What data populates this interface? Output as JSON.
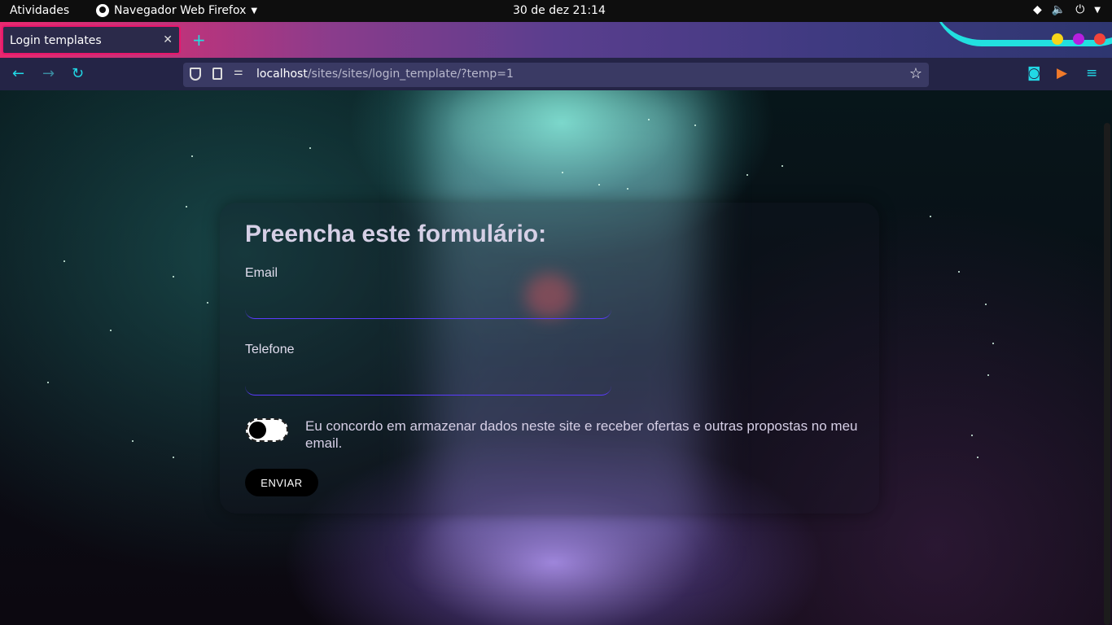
{
  "topbar": {
    "activities": "Atividades",
    "app_name": "Navegador Web Firefox",
    "clock": "30 de dez  21:14"
  },
  "browser": {
    "tab_title": "Login templates",
    "url_host": "localhost",
    "url_path": "/sites/sites/login_template/?temp=1",
    "colors": {
      "tab_border": "#e8176c",
      "accent": "#21d8e6"
    }
  },
  "form": {
    "heading": "Preencha este formulário:",
    "email_label": "Email",
    "email_value": "",
    "phone_label": "Telefone",
    "phone_value": "",
    "consent_text": "Eu concordo em armazenar dados neste site e receber ofertas e outras propostas no meu email.",
    "consent_checked": false,
    "submit_label": "ENVIAR"
  }
}
